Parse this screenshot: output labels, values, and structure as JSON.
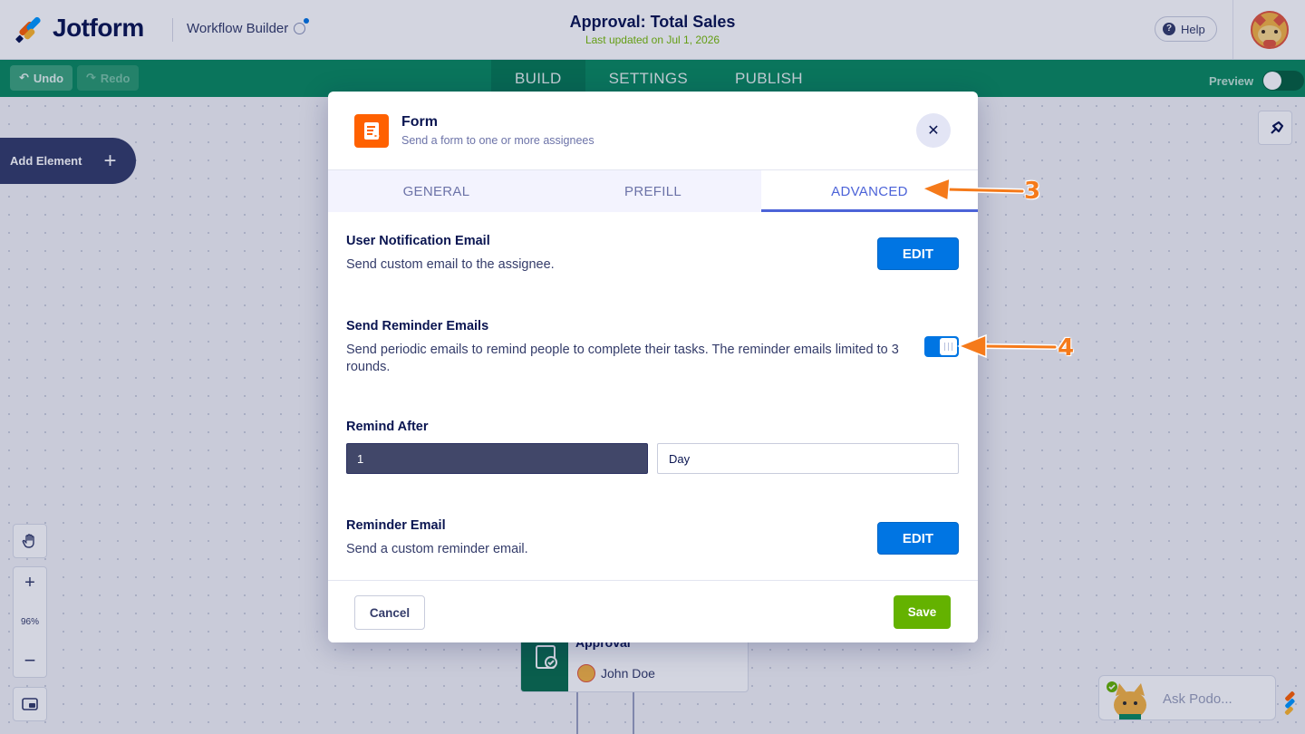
{
  "header": {
    "logo_text": "Jotform",
    "product_name": "Workflow Builder",
    "title": "Approval: Total Sales",
    "last_updated": "Last updated on Jul 1, 2026",
    "help_label": "Help"
  },
  "navbar": {
    "undo_label": "Undo",
    "redo_label": "Redo",
    "tabs": [
      {
        "label": "BUILD",
        "active": true
      },
      {
        "label": "SETTINGS",
        "active": false
      },
      {
        "label": "PUBLISH",
        "active": false
      }
    ],
    "preview_label": "Preview",
    "preview_on": false
  },
  "canvas": {
    "add_element_label": "Add Element",
    "zoom_level": "96%",
    "node": {
      "title": "Approval",
      "assignee": "John Doe"
    },
    "ask_podo": "Ask Podo...",
    "watermark_text": "Jotform"
  },
  "modal": {
    "title": "Form",
    "subtitle": "Send a form to one or more assignees",
    "tabs": [
      {
        "label": "GENERAL",
        "active": false
      },
      {
        "label": "PREFILL",
        "active": false
      },
      {
        "label": "ADVANCED",
        "active": true
      }
    ],
    "user_notification": {
      "title": "User Notification Email",
      "description": "Send custom email to the assignee.",
      "button": "EDIT"
    },
    "send_reminder": {
      "title": "Send Reminder Emails",
      "description": "Send periodic emails to remind people to complete their tasks. The reminder emails limited to 3 rounds.",
      "enabled": true
    },
    "remind_after": {
      "title": "Remind After",
      "value": "1",
      "unit": "Day"
    },
    "reminder_email": {
      "title": "Reminder Email",
      "description": "Send a custom reminder email.",
      "button": "EDIT"
    },
    "footer": {
      "cancel_label": "Cancel",
      "save_label": "Save"
    }
  },
  "annotations": [
    {
      "label": "3",
      "points_to": "ADVANCED tab"
    },
    {
      "label": "4",
      "points_to": "Send Reminder Emails toggle"
    }
  ],
  "colors": {
    "brand_navy": "#0a1551",
    "nav_green": "#0a8a5e",
    "primary_blue": "#0075e3",
    "save_green": "#64b200",
    "form_orange": "#ff6100",
    "tab_active": "#4c63d8",
    "annotation_orange": "#f57a1a"
  }
}
